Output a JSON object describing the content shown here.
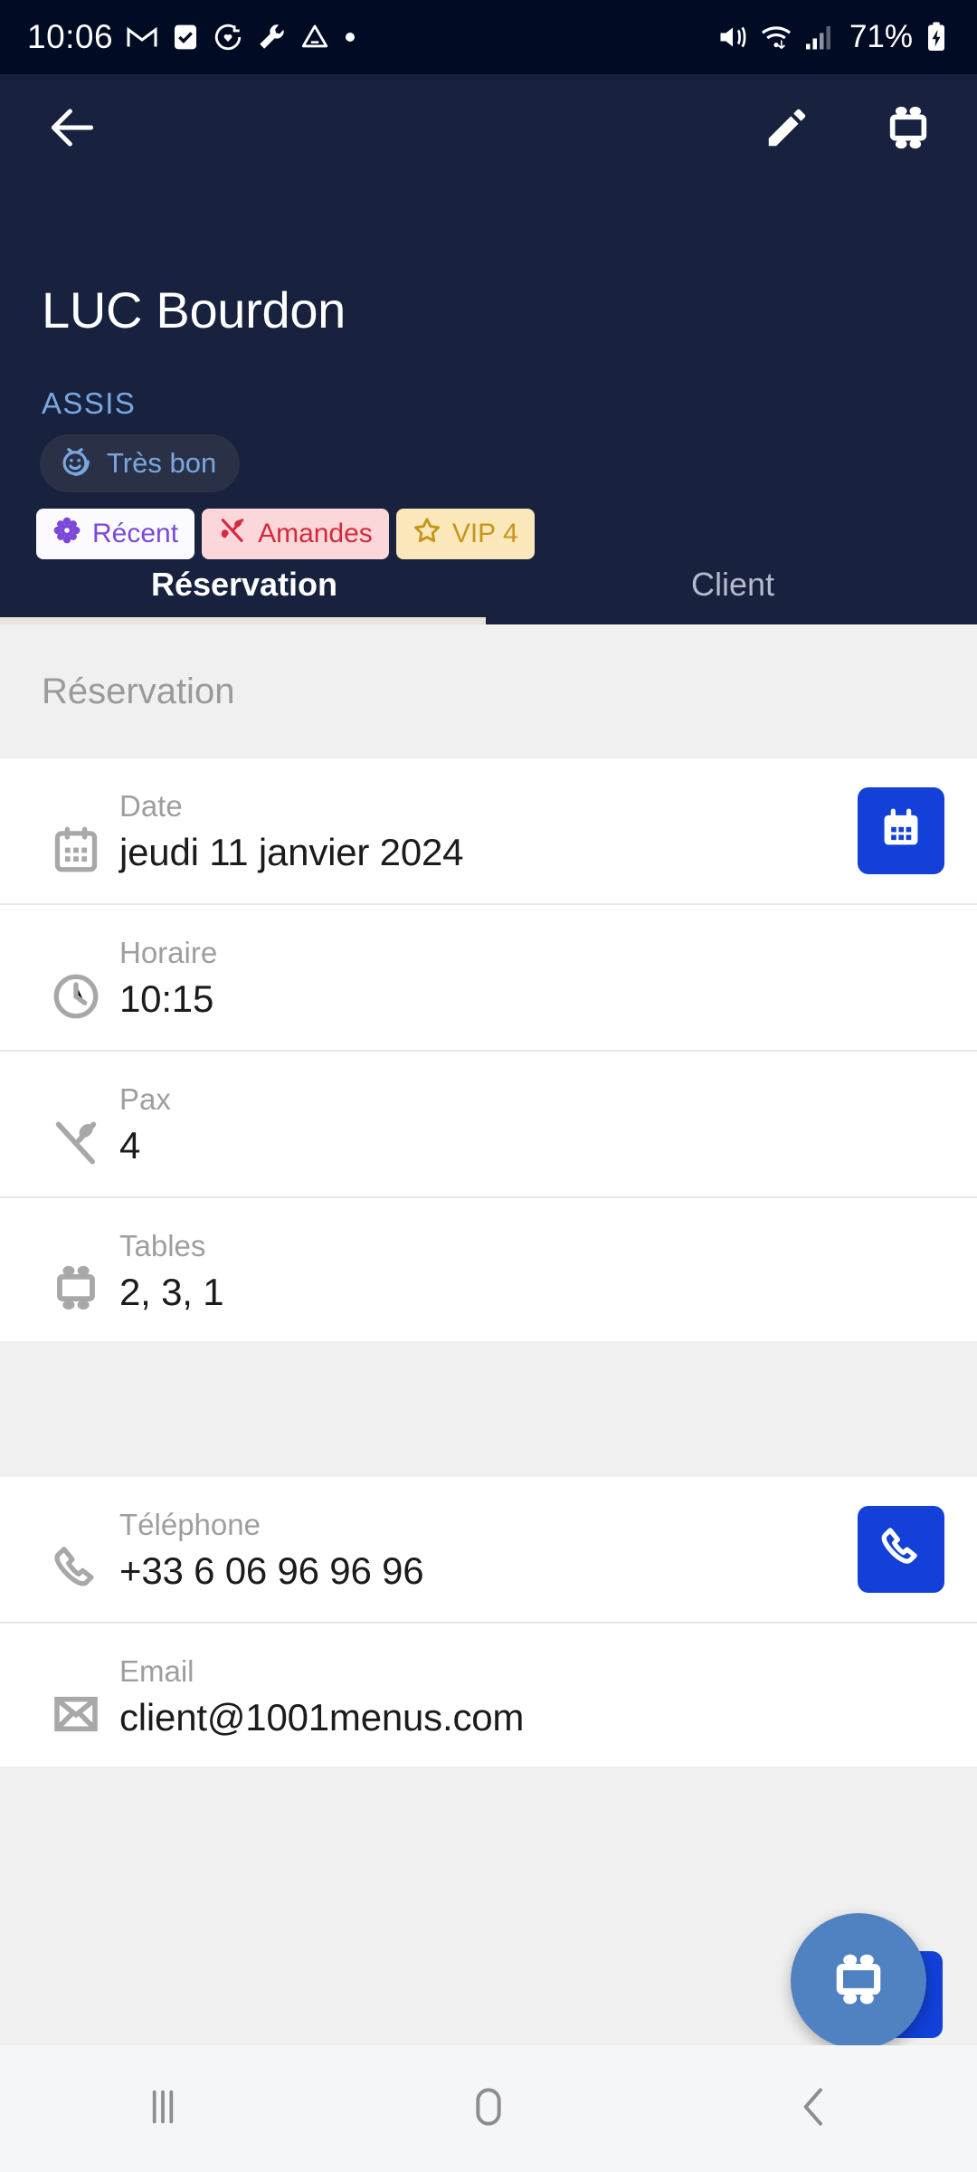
{
  "status_bar": {
    "time": "10:06",
    "battery_percent": "71%",
    "left_icons": [
      "gmail-icon",
      "checkbox-icon",
      "clock-heart-icon",
      "wrench-icon",
      "drive-icon",
      "dot-icon"
    ],
    "right_icons": [
      "mute-vibrate-icon",
      "wifi-icon",
      "signal-icon",
      "battery-charging-icon"
    ]
  },
  "header": {
    "background_color": "#18223f",
    "back_icon": "arrow-left-icon",
    "edit_icon": "pencil-icon",
    "table_icon": "table-icon",
    "customer_name": "LUC Bourdon",
    "reservation_status": "ASSIS",
    "rating_chip": {
      "icon": "smiley-icon",
      "label": "Très bon",
      "background_color": "#2a3147",
      "text_color": "#7aa7e0"
    },
    "tags": [
      {
        "icon": "flower-icon",
        "label": "Récent",
        "background_color": "#fbfbff",
        "text_color": "#7b48d8"
      },
      {
        "icon": "cutlery-icon",
        "label": "Amandes",
        "background_color": "#fbd7d9",
        "text_color": "#d22b3e"
      },
      {
        "icon": "star-icon",
        "label": "VIP 4",
        "background_color": "#fae8bb",
        "text_color": "#c8941a"
      }
    ]
  },
  "tabs": [
    {
      "label": "Réservation",
      "active": true
    },
    {
      "label": "Client",
      "active": false
    }
  ],
  "section": {
    "title": "Réservation"
  },
  "reservation_rows": [
    {
      "icon": "calendar-icon",
      "label": "Date",
      "value": "jeudi 11 janvier 2024",
      "action_icon": "calendar-icon",
      "has_action": true
    },
    {
      "icon": "clock-icon",
      "label": "Horaire",
      "value": "10:15",
      "action_icon": "",
      "has_action": false
    },
    {
      "icon": "cutlery-icon",
      "label": "Pax",
      "value": "4",
      "action_icon": "",
      "has_action": false
    },
    {
      "icon": "table-icon",
      "label": "Tables",
      "value": "2, 3, 1",
      "action_icon": "",
      "has_action": false
    }
  ],
  "contact_rows": [
    {
      "icon": "phone-icon",
      "label": "Téléphone",
      "value": "+33 6 06 96 96 96",
      "action_icon": "phone-icon",
      "has_action": true
    },
    {
      "icon": "email-icon",
      "label": "Email",
      "value": "client@1001menus.com",
      "action_icon": "",
      "has_action": false
    }
  ],
  "fab": {
    "icon": "table-icon",
    "background_color": "#5081c0"
  },
  "accent_color": "#1240d8",
  "nav_bar": {
    "recents_icon": "recents-icon",
    "home_icon": "home-icon",
    "back_icon": "back-chevron-icon"
  }
}
